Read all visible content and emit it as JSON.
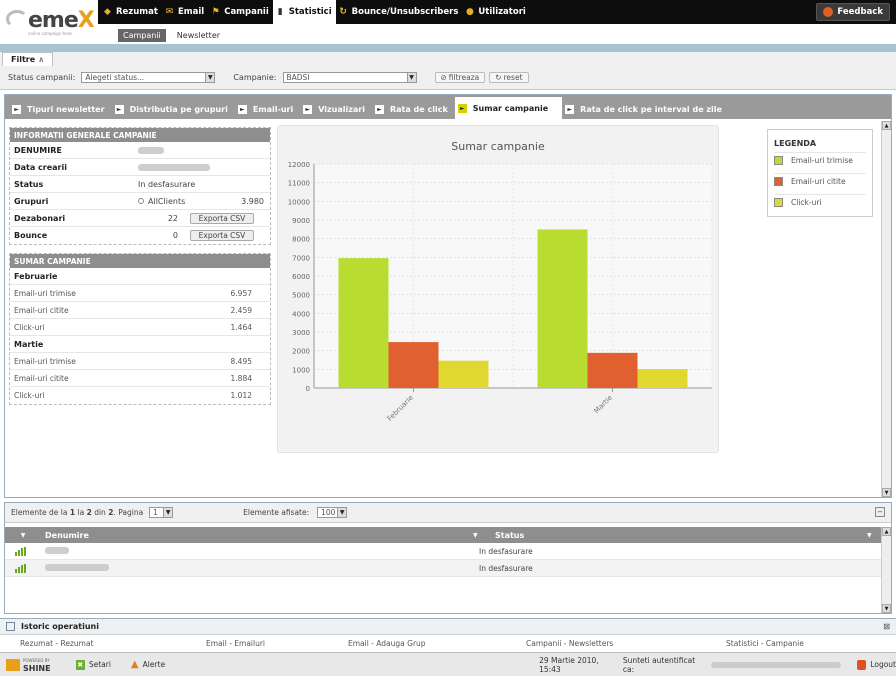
{
  "brand": {
    "logo_text": "eme",
    "logo_x": "X",
    "logo_sub": "online campaign tools"
  },
  "topnav": [
    {
      "label": "Rezumat",
      "icon": "diamond-icon",
      "color": "#e8b020"
    },
    {
      "label": "Email",
      "icon": "envelope-icon",
      "color": "#f0c040"
    },
    {
      "label": "Campanii",
      "icon": "tag-icon",
      "color": "#e8b020"
    },
    {
      "label": "Statistici",
      "icon": "bar-chart-icon",
      "color": "#333333",
      "active": true
    },
    {
      "label": "Bounce/Unsubscribers",
      "icon": "bounce-icon",
      "color": "#f0c040"
    },
    {
      "label": "Utilizatori",
      "icon": "users-icon",
      "color": "#e8b020"
    }
  ],
  "feedback_label": "Feedback",
  "subnav": [
    {
      "label": "Campanii",
      "active": true
    },
    {
      "label": "Newsletter"
    }
  ],
  "filters": {
    "tab_label": "Filtre",
    "status_label": "Status campanii:",
    "status_value": "Alegeti status...",
    "campaign_label": "Campanie:",
    "campaign_value": "BADSI",
    "filter_button": "filtreaza",
    "reset_button": "reset"
  },
  "tabs": [
    {
      "label": "Tipuri newsletter"
    },
    {
      "label": "Distributia pe grupuri"
    },
    {
      "label": "Email-uri"
    },
    {
      "label": "Vizualizari"
    },
    {
      "label": "Rata de click"
    },
    {
      "label": "Sumar campanie",
      "active": true
    },
    {
      "label": "Rata de click pe interval de zile"
    }
  ],
  "info": {
    "header": "INFORMATII GENERALE CAMPANIE",
    "rows": {
      "denumire": "DENUMIRE",
      "data_crearii": "Data crearii",
      "status": "Status",
      "status_value": "In desfasurare",
      "grupuri": "Grupuri",
      "grupuri_value": "AllClients",
      "grupuri_count": "3.980",
      "dezabonari": "Dezabonari",
      "dezabonari_value": "22",
      "bounce": "Bounce",
      "bounce_value": "0",
      "export_label": "Exporta CSV"
    }
  },
  "summary": {
    "header": "SUMAR CAMPANIE",
    "months": [
      {
        "name": "Februarie",
        "rows": [
          {
            "label": "Email-uri trimise",
            "value": "6.957"
          },
          {
            "label": "Email-uri citite",
            "value": "2.459"
          },
          {
            "label": "Click-uri",
            "value": "1.464"
          }
        ]
      },
      {
        "name": "Martie",
        "rows": [
          {
            "label": "Email-uri trimise",
            "value": "8.495"
          },
          {
            "label": "Email-uri citite",
            "value": "1.884"
          },
          {
            "label": "Click-uri",
            "value": "1.012"
          }
        ]
      }
    ]
  },
  "chart_data": {
    "type": "bar",
    "title": "Sumar campanie",
    "categories": [
      "Februarie",
      "Martie"
    ],
    "series": [
      {
        "name": "Email-uri trimise",
        "values": [
          6957,
          8495
        ],
        "color": "#b8dc30"
      },
      {
        "name": "Email-uri citite",
        "values": [
          2459,
          1884
        ],
        "color": "#e06030"
      },
      {
        "name": "Click-uri",
        "values": [
          1464,
          1012
        ],
        "color": "#e0d830"
      }
    ],
    "ylim": [
      0,
      12000
    ],
    "yticks": [
      0,
      1000,
      2000,
      3000,
      4000,
      5000,
      6000,
      7000,
      8000,
      9000,
      10000,
      11000,
      12000
    ],
    "grid": true,
    "legend": "right",
    "xlabel": "",
    "ylabel": ""
  },
  "legend_title": "LEGENDA",
  "grid": {
    "pager_prefix": "Elemente de la",
    "pager_from": "1",
    "pager_mid": "la",
    "pager_to": "2",
    "pager_din": "din",
    "pager_total": "2",
    "pager_page_label": "Pagina",
    "page_value": "1",
    "shown_label": "Elemente afisate:",
    "shown_value": "100",
    "columns": [
      "Denumire",
      "Status"
    ],
    "rows": [
      {
        "status": "In desfasurare"
      },
      {
        "status": "In desfasurare"
      }
    ]
  },
  "history": {
    "title": "Istoric operatiuni",
    "items": [
      "Rezumat - Rezumat",
      "Email - Emailuri",
      "Email - Adauga Grup",
      "Campanii - Newsletters",
      "Statistici - Campanie"
    ]
  },
  "statusbar": {
    "powered": "POWERED BY",
    "shine": "SHINE",
    "setari": "Setari",
    "alerte": "Alerte",
    "datetime": "29 Martie 2010, 15:43",
    "auth": "Sunteti autentificat ca:",
    "logout": "Logout"
  }
}
